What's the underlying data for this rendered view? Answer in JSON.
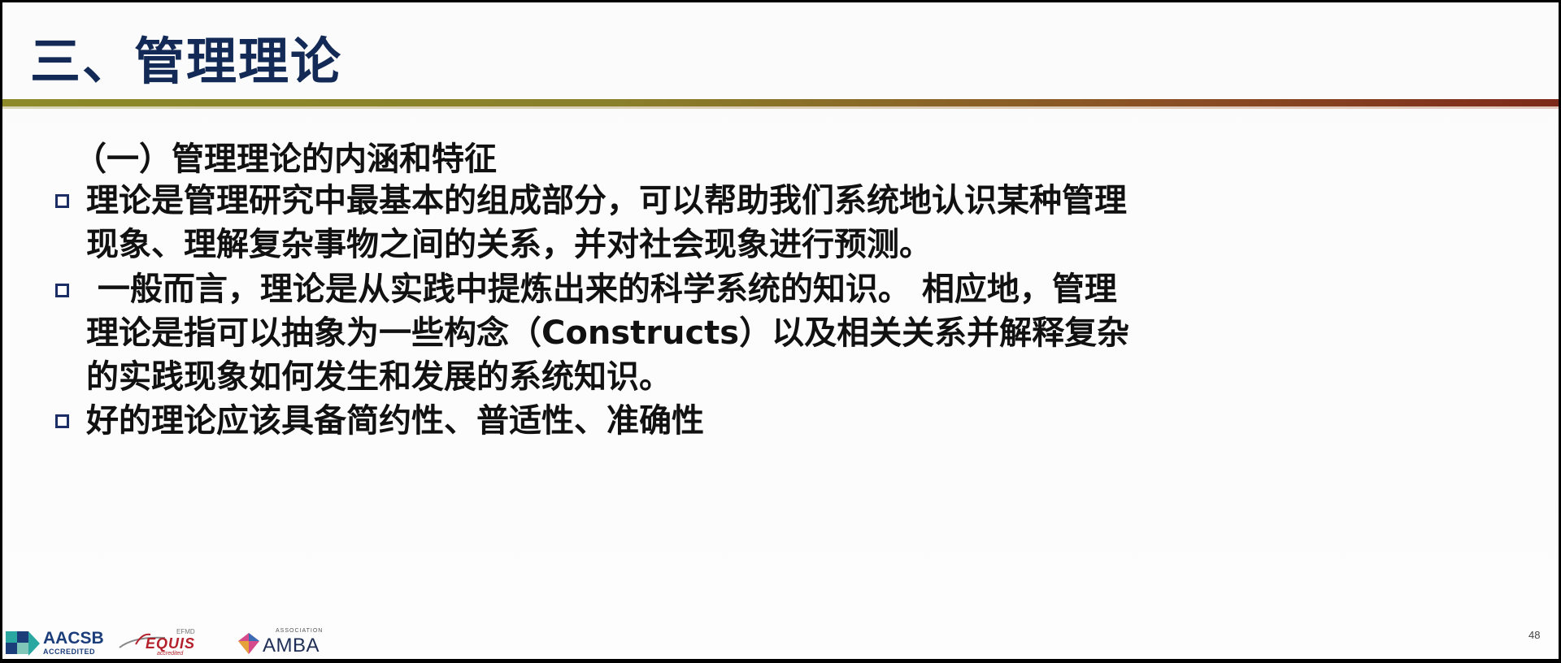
{
  "slide": {
    "title": "三、管理理论",
    "subheading": "（一）管理理论的内涵和特征",
    "bullets": [
      {
        "lines": [
          "理论是管理研究中最基本的组成部分，可以帮助我们系统地认识某种管理",
          "现象、理解复杂事物之间的关系，并对社会现象进行预测。"
        ]
      },
      {
        "lines": [
          " 一般而言，理论是从实践中提炼出来的科学系统的知识。 相应地，管理",
          "理论是指可以抽象为一些构念（Constructs）以及相关关系并解释复杂",
          "的实践现象如何发生和发展的系统知识。"
        ]
      },
      {
        "lines": [
          "好的理论应该具备简约性、普适性、准确性"
        ]
      }
    ],
    "page_number": "48"
  },
  "footer": {
    "aacsb": {
      "name": "AACSB",
      "sub": "ACCREDITED"
    },
    "equis": {
      "top": "EFMD",
      "name": "EQUIS",
      "sub": "accredited"
    },
    "amba": {
      "top": "ASSOCIATION",
      "name": "AMBA"
    }
  },
  "colors": {
    "title": "#122a55",
    "bullet_border": "#1b2f66",
    "bar_left": "#8d8a2a",
    "bar_right": "#7e2a1a",
    "equis_red": "#b3202a"
  }
}
